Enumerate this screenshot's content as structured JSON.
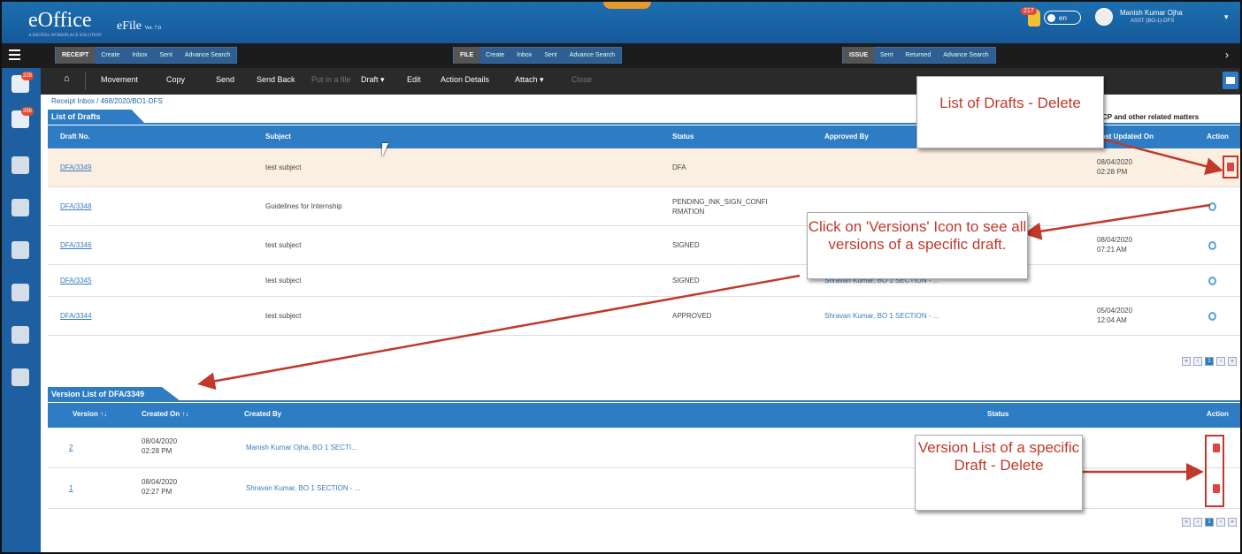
{
  "header": {
    "logo": "eOffice",
    "logo_sub": "A DIGITAL WORKPLACE SOLUTION",
    "efile": "eFile",
    "version": "Ver. 7.0",
    "notifications": "217",
    "lang": "en",
    "user_name": "Manish Kumar Ojha",
    "user_designation": "ASST (BO-1)-DFS"
  },
  "menubar": {
    "receipt": [
      "RECEIPT",
      "Create",
      "Inbox",
      "Sent",
      "Advance Search"
    ],
    "file": [
      "FILE",
      "Create",
      "Inbox",
      "Sent",
      "Advance Search"
    ],
    "issue": [
      "ISSUE",
      "Sent",
      "Returned",
      "Advance Search"
    ]
  },
  "toolbar": {
    "home": "⌂",
    "items": [
      "Movement",
      "Copy",
      "Send",
      "Send Back",
      "Put in a file",
      "Draft ▾",
      "Edit",
      "Action Details",
      "Attach ▾",
      "Close"
    ]
  },
  "sidebar": {
    "badges": [
      "228",
      "266"
    ]
  },
  "breadcrumb": {
    "path": "Receipt Inbox /",
    "current": "468/2020/BO1-DFS",
    "right": "CP and other related matters"
  },
  "drafts": {
    "title": "List of Drafts",
    "columns": [
      "Draft No.",
      "Subject",
      "Status",
      "Approved By",
      "Last Updated On",
      "Action"
    ],
    "rows": [
      {
        "no": "DFA/3349",
        "subject": "test subject",
        "status": "DFA",
        "approved": "",
        "updated": "08/04/2020 02:28 PM"
      },
      {
        "no": "DFA/3348",
        "subject": "Guidelines for Internship",
        "status": "PENDING_INK_SIGN_CONFIRMATION",
        "approved": "",
        "updated": ""
      },
      {
        "no": "DFA/3346",
        "subject": "test subject",
        "status": "SIGNED",
        "approved": "",
        "updated": "08/04/2020 07:21 AM"
      },
      {
        "no": "DFA/3345",
        "subject": "test subject",
        "status": "SIGNED",
        "approved": "Shravan Kumar, BO 1 SECTION - ...",
        "updated": ""
      },
      {
        "no": "DFA/3344",
        "subject": "test subject",
        "status": "APPROVED",
        "approved": "Shravan Kumar, BO 1 SECTION - ...",
        "updated": "05/04/2020 12:04 AM"
      }
    ]
  },
  "versions": {
    "title": "Version List of DFA/3349",
    "columns": [
      "Version ↑↓",
      "Created On ↑↓",
      "Created By",
      "Status",
      "Action"
    ],
    "rows": [
      {
        "version": "2",
        "created_on": "08/04/2020 02:28 PM",
        "created_by": "Manish Kumar Ojha, BO 1 SECTI..."
      },
      {
        "version": "1",
        "created_on": "08/04/2020 02:27 PM",
        "created_by": "Shravan Kumar, BO 1 SECTION - ..."
      }
    ]
  },
  "pager": {
    "current": "1"
  },
  "callouts": {
    "drafts_delete": "List of Drafts - Delete",
    "versions_icon": "Click on 'Versions' Icon to see all versions of a specific draft.",
    "version_delete": "Version List of a specific Draft - Delete"
  },
  "colors": {
    "primary": "#2d7cc4",
    "callout": "#c0392b"
  }
}
